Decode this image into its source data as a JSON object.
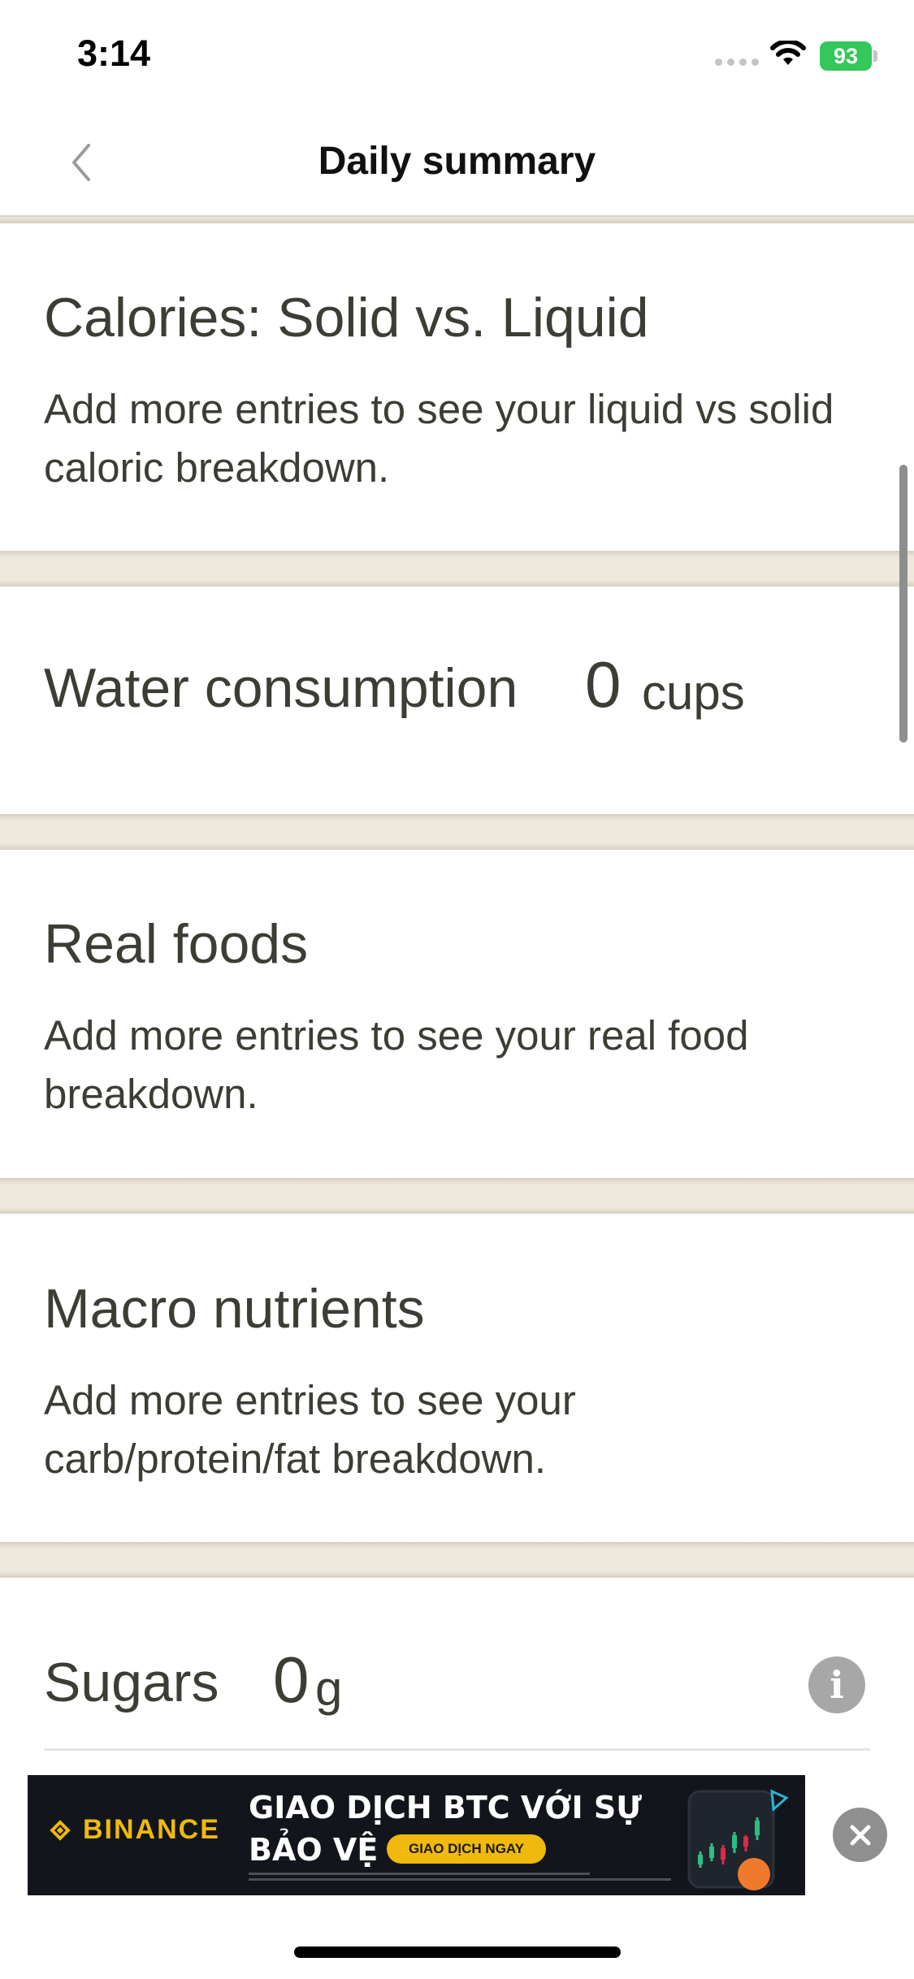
{
  "status_bar": {
    "time": "3:14",
    "battery": "93"
  },
  "nav": {
    "title": "Daily summary",
    "back_icon": "chevron-left-icon"
  },
  "sections": {
    "calories": {
      "title": "Calories: Solid vs. Liquid",
      "description": "Add more entries to see your liquid vs solid caloric breakdown."
    },
    "water": {
      "label": "Water consumption",
      "value": "0",
      "unit": "cups"
    },
    "real_foods": {
      "title": "Real foods",
      "description": "Add more entries to see your real food breakdown."
    },
    "macros": {
      "title": "Macro nutrients",
      "description": "Add more entries to see your carb/protein/fat breakdown."
    },
    "sugars": {
      "label": "Sugars",
      "value": "0",
      "unit": "g",
      "info_icon": "info-icon",
      "info_glyph": "i"
    }
  },
  "ad": {
    "brand": "BINANCE",
    "headline_line1": "GIAO DỊCH BTC VỚI SỰ",
    "headline_line2": "BẢO VỆ",
    "cta": "GIAO DỊCH NGAY",
    "close_icon": "close-icon"
  },
  "colors": {
    "background": "#ffffff",
    "separator": "#efe9dd",
    "text": "#3d3d35",
    "battery": "#34c759",
    "ad_background": "#12161c",
    "ad_accent": "#f0b90b"
  }
}
